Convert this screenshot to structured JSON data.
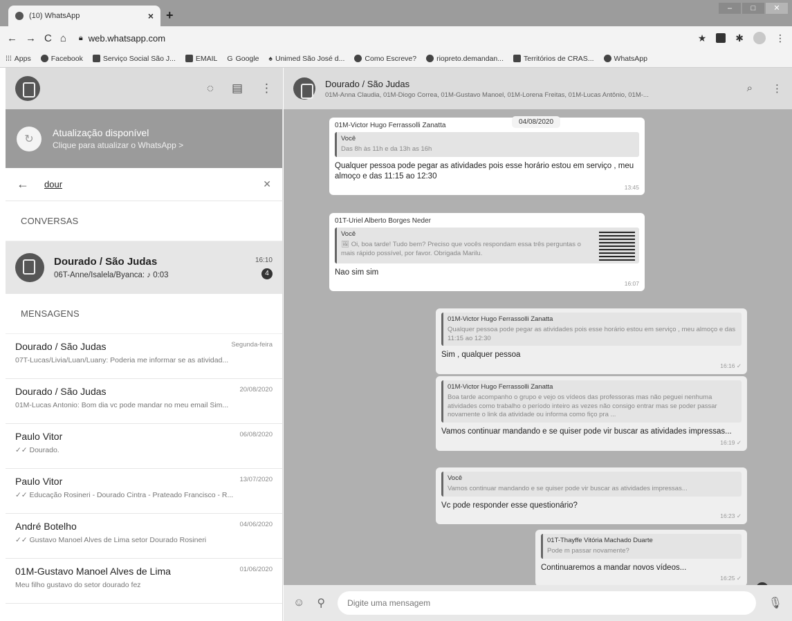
{
  "browser": {
    "tab_title": "(10) WhatsApp",
    "tab_close": "×",
    "new_tab": "+",
    "url": "web.whatsapp.com",
    "bookmarks": [
      "Apps",
      "Facebook",
      "Serviço Social São J...",
      "EMAIL",
      "Google",
      "Unimed São José d...",
      "Como Escreve?",
      "riopreto.demandan...",
      "Territórios de CRAS...",
      "WhatsApp"
    ]
  },
  "sidebar": {
    "update_title": "Atualização disponível",
    "update_subtitle": "Clique para atualizar o WhatsApp >",
    "search_value": "dour",
    "section_conversas": "CONVERSAS",
    "section_mensagens": "MENSAGENS",
    "active_chat": {
      "name": "Dourado / São Judas",
      "preview": "06T-Anne/Isalela/Byanca: ♪ 0:03",
      "time": "16:10",
      "badge": "4"
    },
    "messages": [
      {
        "name": "Dourado / São Judas",
        "date": "Segunda-feira",
        "preview": "07T-Lucas/Livia/Luan/Luany: Poderia me informar se as atividad..."
      },
      {
        "name": "Dourado / São Judas",
        "date": "20/08/2020",
        "preview": "01M-Lucas Antonio: Bom dia vc pode mandar no meu email Sim..."
      },
      {
        "name": "Paulo Vitor",
        "date": "06/08/2020",
        "preview": "✓✓ Dourado."
      },
      {
        "name": "Paulo Vitor",
        "date": "13/07/2020",
        "preview": "✓✓ Educação  Rosineri - Dourado Cintra - Prateado Francisco - R..."
      },
      {
        "name": "André Botelho",
        "date": "04/06/2020",
        "preview": "✓✓ Gustavo Manoel Alves de Lima setor Dourado Rosineri"
      },
      {
        "name": "01M-Gustavo Manoel Alves de Lima",
        "date": "01/06/2020",
        "preview": "Meu filho gustavo do setor dourado fez"
      }
    ]
  },
  "chat": {
    "title": "Dourado / São Judas",
    "members": "01M-Anna Claudia, 01M-Diogo Correa, 01M-Gustavo Manoel, 01M-Lorena Freitas, 01M-Lucas Antônio, 01M-...",
    "date_chip": "04/08/2020",
    "m1": {
      "sender": "01M-Victor Hugo Ferrassolli Zanatta",
      "quote_name": "Você",
      "quote_text": "Das 8h às 11h e da 13h as 16h",
      "text": "Qualquer pessoa pode pegar as atividades pois esse horário estou em serviço , meu almoço e das 11:15 ao 12:30",
      "time": "13:45"
    },
    "m2": {
      "sender": "01T-Uriel Alberto Borges Neder",
      "quote_name": "Você",
      "quote_text": "🖼 Oi, boa tarde! Tudo bem? Preciso que vocês respondam essa três perguntas o mais rápido possível, por favor. Obrigada Marilu.",
      "text": "Nao sim sim",
      "time": "16:07"
    },
    "m3": {
      "quote_name": "01M-Victor Hugo Ferrassolli Zanatta",
      "quote_text": "Qualquer pessoa pode pegar as atividades pois esse horário estou em serviço , meu almoço e das 11:15 ao 12:30",
      "text": "Sim , qualquer pessoa",
      "time": "16:16 ✓"
    },
    "m4": {
      "quote_name": "01M-Victor Hugo Ferrassolli Zanatta",
      "quote_text": "Boa tarde acompanho o grupo e vejo os vídeos das professoras mas não peguei nenhuma atividades como trabalho o período inteiro as vezes não consigo entrar mas se poder passar novamente o link da atividade ou informa como fiço pra ...",
      "text": "Vamos continuar mandando e se quiser pode vir buscar as atividades impressas...",
      "time": "16:19 ✓"
    },
    "m5": {
      "quote_name": "Você",
      "quote_text": "Vamos continuar mandando e se quiser pode vir buscar as atividades impressas...",
      "text": "Vc pode responder esse questionário?",
      "time": "16:23 ✓"
    },
    "m6": {
      "quote_name": "01T-Thayffe Vitória Machado Duarte",
      "quote_text": "Pode m passar novamente?",
      "text": "Continuaremos a mandar novos vídeos...",
      "time": "16:25 ✓"
    },
    "scroll_badge": "4",
    "composer_placeholder": "Digite uma mensagem"
  }
}
